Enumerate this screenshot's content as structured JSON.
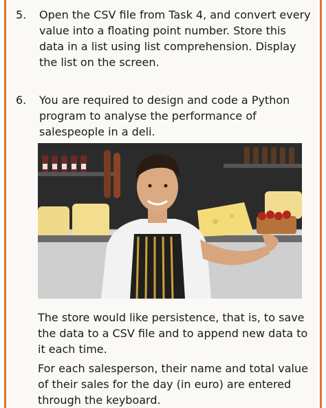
{
  "tasks": [
    {
      "number": "5.",
      "text": "Open the CSV file from Task 4, and convert every value into a floating point number. Store this data in a list using list comprehension. Display the list on the screen."
    },
    {
      "number": "6.",
      "text": "You are required to design and code a Python program to analyse the performance of salespeople in a deli."
    }
  ],
  "paragraphs": [
    "The store would like persistence, that is, to save the data to a CSV file and to append new data to it each time.",
    "For each salesperson, their name and total value of their sales for the day (in euro) are entered through the keyboard."
  ],
  "colors": {
    "border_accent": "#e0762a",
    "page_background": "#fbf9f6"
  }
}
